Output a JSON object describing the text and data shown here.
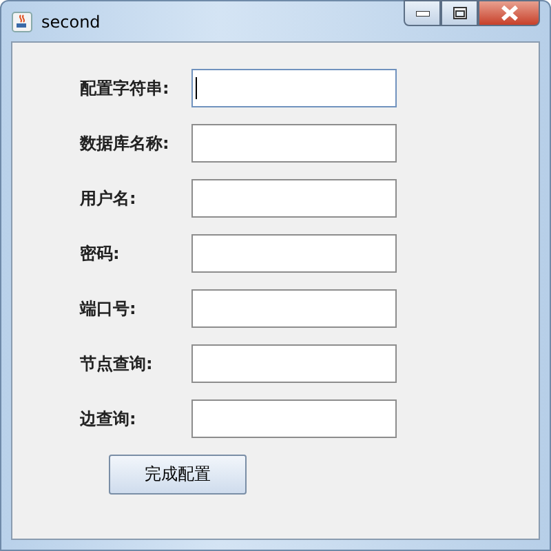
{
  "window": {
    "title": "second"
  },
  "fields": [
    {
      "label": "配置字符串:",
      "focused": true
    },
    {
      "label": "数据库名称:",
      "focused": false
    },
    {
      "label": "用户名:",
      "focused": false
    },
    {
      "label": "密码:",
      "focused": false
    },
    {
      "label": "端口号:",
      "focused": false
    },
    {
      "label": "节点查询:",
      "focused": false
    },
    {
      "label": "边查询:",
      "focused": false
    }
  ],
  "buttons": [
    "完成配置"
  ]
}
